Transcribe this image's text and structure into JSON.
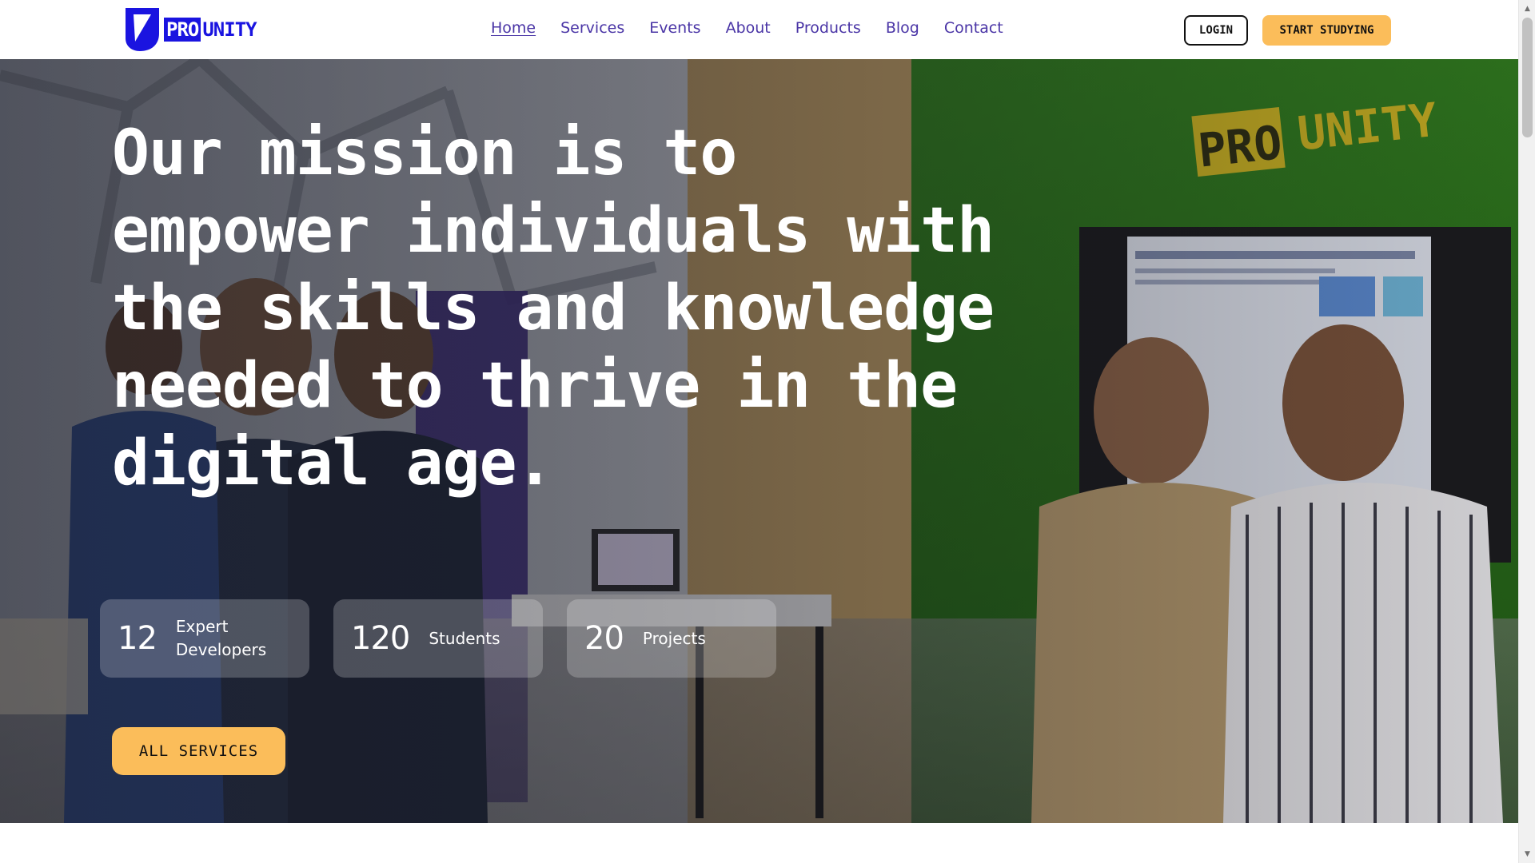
{
  "brand": {
    "logo_pro": "PRO",
    "logo_unity": "UNITY",
    "logo_icon": "prounity-shield-logo"
  },
  "nav": {
    "items": [
      {
        "label": "Home",
        "active": true
      },
      {
        "label": "Services"
      },
      {
        "label": "Events"
      },
      {
        "label": "About"
      },
      {
        "label": "Products"
      },
      {
        "label": "Blog"
      },
      {
        "label": "Contact"
      }
    ]
  },
  "header": {
    "login_label": "LOGIN",
    "start_label": "START STUDYING"
  },
  "hero": {
    "heading": "Our mission is to empower individuals with the skills and knowledge needed to thrive in the digital age.",
    "wall_sign": "PRO UNITY",
    "stats": [
      {
        "value": "12",
        "label": "Expert Developers"
      },
      {
        "value": "120",
        "label": "Students"
      },
      {
        "value": "20",
        "label": "Projects"
      }
    ],
    "all_services_label": "ALL SERVICES"
  },
  "colors": {
    "brand_blue": "#1a14e0",
    "nav_text": "#4a35a6",
    "accent_yellow": "#fbbd5a"
  },
  "scrollbar": {
    "up_icon": "scroll-up-arrow-icon",
    "down_icon": "scroll-down-arrow-icon"
  }
}
